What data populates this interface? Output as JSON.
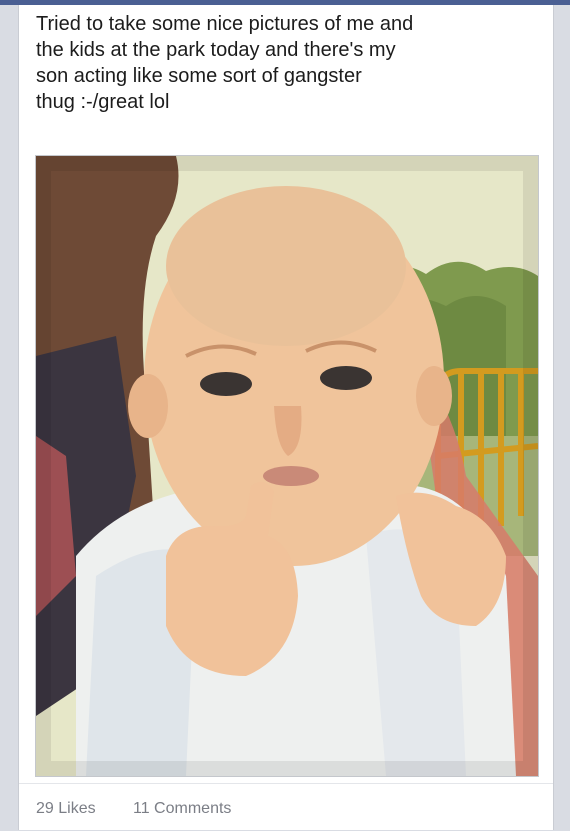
{
  "post": {
    "text": "Tried to take some nice pictures of me and\nthe kids at the park today and there's my\nson acting like some sort of gangster\nthug :-/great lol"
  },
  "footer": {
    "likes_label": "29 Likes",
    "comments_label": "11 Comments"
  },
  "colors": {
    "topbar": "#4a5f93",
    "card": "#ffffff",
    "footer_text": "#7b7e86"
  }
}
